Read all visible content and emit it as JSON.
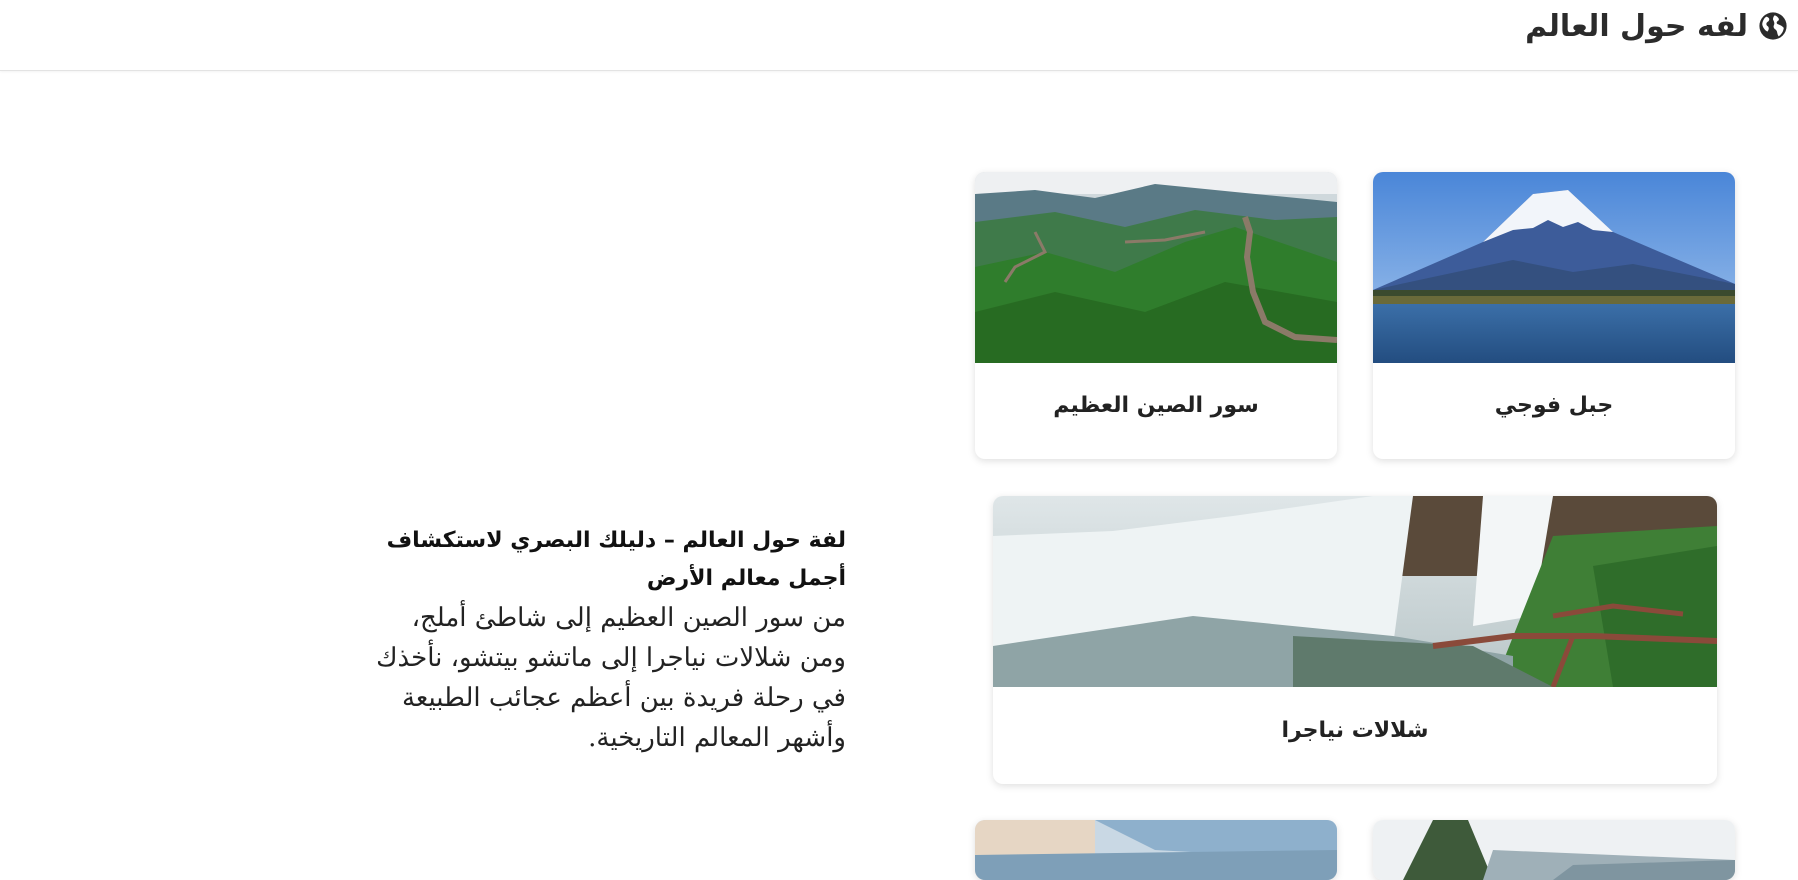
{
  "header": {
    "title": "لفه حول العالم",
    "icon": "globe-icon"
  },
  "cards": {
    "great_wall": {
      "label": "سور الصين العظيم",
      "image": "great-wall-photo"
    },
    "mount_fuji": {
      "label": "جبل فوجي",
      "image": "mount-fuji-photo"
    },
    "niagara": {
      "label": "شلالات نياجرا",
      "image": "niagara-falls-photo"
    },
    "partial_left": {
      "image": "coastal-sky-photo"
    },
    "partial_right": {
      "image": "mountain-peak-photo"
    }
  },
  "intro": {
    "heading": "لفة حول العالم – دليلك البصري لاستكشاف أجمل معالم الأرض",
    "body": "من سور الصين العظيم إلى شاطئ أملج، ومن شلالات نياجرا إلى ماتشو بيتشو، نأخذك في رحلة فريدة بين أعظم عجائب الطبيعة وأشهر المعالم التاريخية."
  },
  "colors": {
    "accent_text": "#2b2b2b",
    "card_bg": "#ffffff",
    "border": "#e3e3e3"
  }
}
